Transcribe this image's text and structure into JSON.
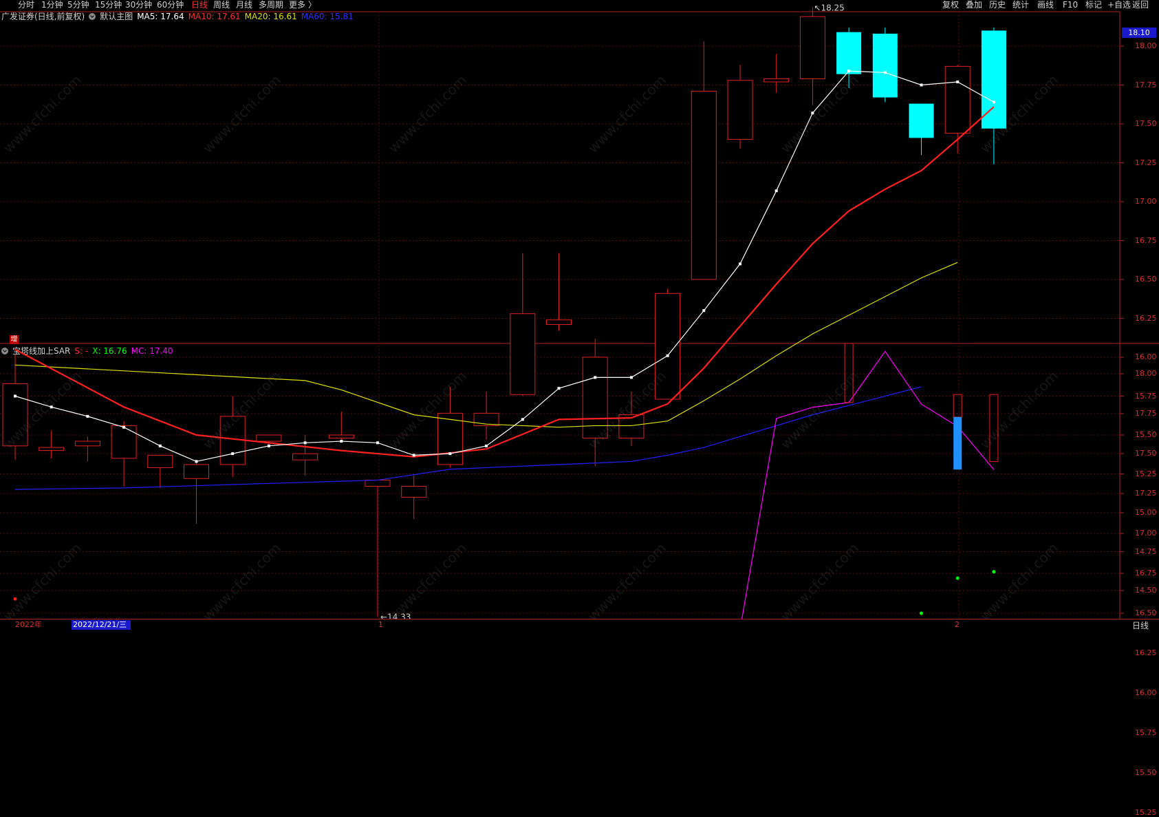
{
  "toolbar": {
    "left": [
      "分时",
      "1分钟",
      "5分钟",
      "15分钟",
      "30分钟",
      "60分钟",
      "日线",
      "周线",
      "月线",
      "多周期",
      "更多 〉"
    ],
    "active": "日线",
    "right": [
      "复权",
      "叠加",
      "历史",
      "统计",
      "画线",
      "F10",
      "标记",
      "+自选",
      "返回"
    ]
  },
  "main_header": {
    "title": "广发证券(日线,前复权)",
    "template": "默认主图",
    "ma5": "MA5: 17.64",
    "ma10": "MA10: 17.61",
    "ma20": "MA20: 16.61",
    "ma60": "MA60: 15.81"
  },
  "sub_header": {
    "title": "宝塔线加上SAR",
    "s": "S: -",
    "x": "X: 16.76",
    "mc": "MC: 17.40"
  },
  "zeng_label": "增",
  "current_price": "18.10",
  "annotations": {
    "high": "18.25",
    "low": "14.33"
  },
  "main_axis": [
    "18.00",
    "17.75",
    "17.50",
    "17.25",
    "17.00",
    "16.75",
    "16.50",
    "16.25",
    "16.00",
    "15.75",
    "15.50",
    "15.25",
    "15.00",
    "14.75",
    "14.50"
  ],
  "sub_axis": [
    "18.00",
    "17.75",
    "17.50",
    "17.25",
    "17.00",
    "16.75",
    "16.50",
    "16.25",
    "16.00",
    "15.75",
    "15.50",
    "15.25"
  ],
  "bottom": {
    "year": "2022年",
    "cursor_date": "2022/12/21/三",
    "month1": "1",
    "month2": "2",
    "period": "日线"
  },
  "watermark": "www.cfchi.com",
  "colors": {
    "up": "#e02020",
    "down": "#00ffff",
    "ma5": "#ffffff",
    "ma10": "#ff2020",
    "ma20": "#e0e000",
    "ma60": "#2020ff",
    "mc": "#ff00ff",
    "sar_up": "#00ff00",
    "sar_down": "#ff2020",
    "tower_down": "#1e90ff"
  },
  "chart_data": {
    "type": "candlestick",
    "candles": [
      {
        "o": 15.43,
        "h": 16.02,
        "l": 15.34,
        "c": 15.83
      },
      {
        "o": 15.4,
        "h": 15.53,
        "l": 15.35,
        "c": 15.42
      },
      {
        "o": 15.43,
        "h": 15.49,
        "l": 15.33,
        "c": 15.46
      },
      {
        "o": 15.35,
        "h": 15.59,
        "l": 15.17,
        "c": 15.56
      },
      {
        "o": 15.29,
        "h": 15.37,
        "l": 15.16,
        "c": 15.37
      },
      {
        "o": 15.22,
        "h": 15.33,
        "l": 14.93,
        "c": 15.31
      },
      {
        "o": 15.31,
        "h": 15.75,
        "l": 15.23,
        "c": 15.62
      },
      {
        "o": 15.46,
        "h": 15.5,
        "l": 15.44,
        "c": 15.5
      },
      {
        "o": 15.34,
        "h": 15.5,
        "l": 15.24,
        "c": 15.38
      },
      {
        "o": 15.48,
        "h": 15.65,
        "l": 15.46,
        "c": 15.5
      },
      {
        "o": 15.17,
        "h": 15.18,
        "l": 14.33,
        "c": 15.21
      },
      {
        "o": 15.1,
        "h": 15.24,
        "l": 14.96,
        "c": 15.17
      },
      {
        "o": 15.31,
        "h": 15.81,
        "l": 15.29,
        "c": 15.64
      },
      {
        "o": 15.56,
        "h": 15.78,
        "l": 15.47,
        "c": 15.64
      },
      {
        "o": 15.76,
        "h": 16.67,
        "l": 15.75,
        "c": 16.28
      },
      {
        "o": 16.21,
        "h": 16.67,
        "l": 16.17,
        "c": 16.24
      },
      {
        "o": 15.48,
        "h": 16.12,
        "l": 15.3,
        "c": 16.0
      },
      {
        "o": 15.48,
        "h": 15.78,
        "l": 15.43,
        "c": 15.63
      },
      {
        "o": 15.73,
        "h": 16.44,
        "l": 15.73,
        "c": 16.41
      },
      {
        "o": 16.5,
        "h": 18.03,
        "l": 16.5,
        "c": 17.71
      },
      {
        "o": 17.4,
        "h": 17.88,
        "l": 17.34,
        "c": 17.78
      },
      {
        "o": 17.77,
        "h": 17.95,
        "l": 17.7,
        "c": 17.79
      },
      {
        "o": 17.79,
        "h": 18.25,
        "l": 17.62,
        "c": 18.19
      },
      {
        "o": 18.09,
        "h": 18.12,
        "l": 17.73,
        "c": 17.82
      },
      {
        "o": 18.08,
        "h": 18.12,
        "l": 17.64,
        "c": 17.67
      },
      {
        "o": 17.63,
        "h": 17.63,
        "l": 17.3,
        "c": 17.41
      },
      {
        "o": 17.44,
        "h": 17.88,
        "l": 17.31,
        "c": 17.87
      },
      {
        "o": 18.1,
        "h": 18.12,
        "l": 17.24,
        "c": 17.47
      }
    ],
    "ma5": [
      15.75,
      15.68,
      15.62,
      15.55,
      15.43,
      15.33,
      15.38,
      15.43,
      15.45,
      15.46,
      15.45,
      15.37,
      15.38,
      15.43,
      15.6,
      15.8,
      15.87,
      15.87,
      16.01,
      16.3,
      16.6,
      17.07,
      17.57,
      17.84,
      17.83,
      17.75,
      17.77,
      17.64
    ],
    "ma10": [
      16.05,
      null,
      null,
      15.68,
      null,
      15.5,
      null,
      null,
      null,
      15.4,
      null,
      15.36,
      null,
      15.41,
      null,
      15.6,
      null,
      15.61,
      15.7,
      15.93,
      16.2,
      16.47,
      16.73,
      16.94,
      17.08,
      17.2,
      17.4,
      17.61
    ],
    "ma20": [
      15.95,
      null,
      null,
      null,
      null,
      null,
      null,
      null,
      15.85,
      15.79,
      null,
      15.63,
      15.6,
      15.57,
      15.56,
      15.55,
      15.56,
      15.56,
      15.59,
      15.72,
      15.86,
      16.01,
      16.15,
      16.27,
      16.39,
      16.51,
      16.61
    ],
    "ma60": [
      15.15,
      null,
      null,
      15.16,
      null,
      null,
      null,
      null,
      null,
      null,
      15.21,
      null,
      15.28,
      null,
      15.3,
      null,
      null,
      15.33,
      15.37,
      15.42,
      15.49,
      15.56,
      15.63,
      15.69,
      15.75,
      15.81
    ],
    "sub": {
      "mc": [
        15.83,
        15.83,
        15.42,
        15.42,
        15.42,
        15.35,
        15.31,
        15.17,
        15.49,
        15.49,
        15.41,
        15.49,
        15.2,
        15.2,
        15.62,
        15.65,
        16.25,
        16.25,
        15.63,
        15.63,
        16.4,
        17.72,
        17.79,
        17.82,
        18.14,
        17.81,
        17.67,
        17.4
      ],
      "sar": [
        16.59,
        16.45,
        16.3,
        16.14,
        15.97,
        15.79,
        15.74,
        15.74,
        15.67,
        15.67,
        15.67,
        15.51,
        15.13,
        15.18,
        15.23,
        15.28,
        15.33,
        15.38,
        15.48,
        15.57,
        15.67,
        15.81,
        15.97,
        16.13,
        16.31,
        16.5,
        16.72,
        16.76
      ],
      "sar_dir": [
        "d",
        "d",
        "d",
        "d",
        "d",
        "d",
        "d",
        "d",
        "d",
        "d",
        "d",
        "d",
        "u",
        "u",
        "u",
        "u",
        "u",
        "u",
        "u",
        "u",
        "u",
        "u",
        "u",
        "u",
        "u",
        "u",
        "u",
        "u"
      ],
      "tower": [
        {
          "top": 15.83,
          "bot": 15.42,
          "t": "d"
        },
        null,
        {
          "top": 15.42,
          "bot": 15.4,
          "t": "d"
        },
        {
          "top": 15.37,
          "bot": 15.33,
          "t": "d"
        },
        null,
        null,
        {
          "top": 15.62,
          "bot": 15.22,
          "t": "ud"
        },
        {
          "top": 15.5,
          "bot": 15.38,
          "t": "u"
        },
        {
          "top": 15.5,
          "bot": 15.38,
          "t": "u"
        },
        {
          "top": 15.46,
          "bot": 15.36,
          "t": "d"
        },
        {
          "top": 15.48,
          "bot": 15.18,
          "t": "ud"
        },
        {
          "top": 15.19,
          "bot": 15.17,
          "t": "d"
        },
        {
          "top": 15.17,
          "bot": 15.15,
          "t": "d"
        },
        null,
        null,
        {
          "top": 16.28,
          "bot": 16.24,
          "t": "u"
        },
        {
          "top": 16.28,
          "bot": 16.24,
          "t": "u"
        },
        {
          "top": 15.64,
          "bot": 15.47,
          "t": "d"
        },
        {
          "top": 15.64,
          "bot": 15.47,
          "t": "d"
        },
        null,
        null,
        null,
        null,
        {
          "top": 18.19,
          "bot": 17.82,
          "t": "u"
        },
        null,
        null,
        {
          "top": 17.87,
          "bot": 17.4,
          "t": "ud"
        },
        {
          "top": 17.87,
          "bot": 17.45,
          "t": "u"
        }
      ]
    }
  }
}
